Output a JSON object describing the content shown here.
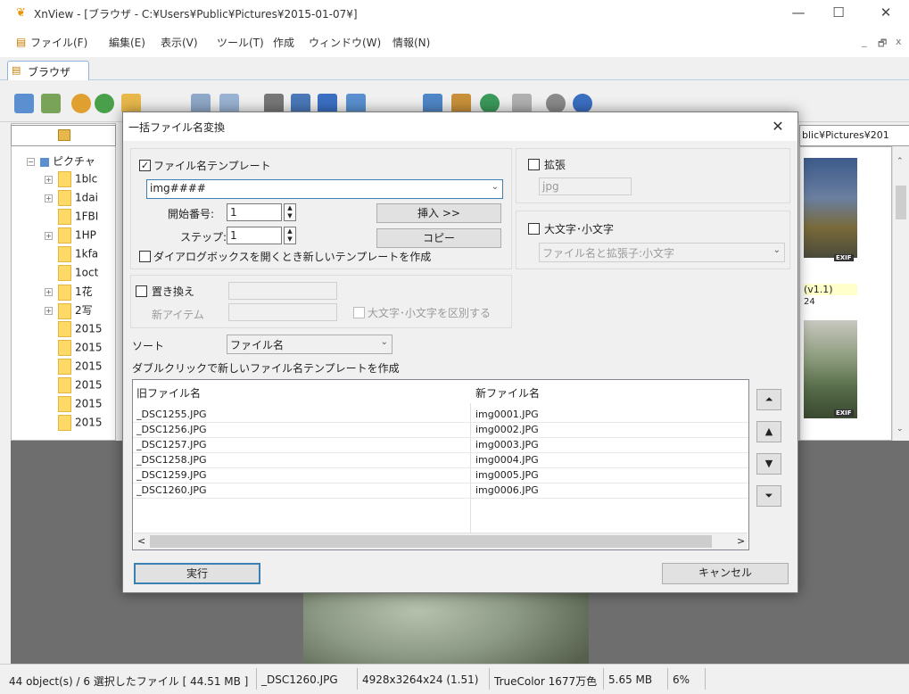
{
  "window": {
    "title": "XnView - [ブラウザ - C:¥Users¥Public¥Pictures¥2015-01-07¥]",
    "minimize": "—",
    "maximize": "☐",
    "close": "✕"
  },
  "menubar": {
    "items": [
      "ファイル(F)",
      "編集(E)",
      "表示(V)",
      "ツール(T)",
      "作成",
      "ウィンドウ(W)",
      "情報(N)"
    ],
    "mdi_min": "_",
    "mdi_restore": "🗗",
    "mdi_close": "x"
  },
  "tab": {
    "label": "ブラウザ"
  },
  "path_right": "blic¥Pictures¥201",
  "tree": {
    "root": "ピクチャ",
    "items": [
      "1blc",
      "1dai",
      "1FBI",
      "1HP",
      "1kfa",
      "1oct",
      "1花",
      "2写",
      "2015",
      "2015",
      "2015",
      "2015",
      "2015",
      "2015"
    ]
  },
  "thumbs": {
    "badge": "EXIF",
    "caption1_line1": "(v1.1)",
    "caption1_line2": "24"
  },
  "dialog": {
    "title": "一括ファイル名変換",
    "close": "✕",
    "template": {
      "checkbox_label": "ファイル名テンプレート",
      "checked": "✓",
      "value": "img####",
      "start_label": "開始番号:",
      "start_value": "1",
      "step_label": "ステップ:",
      "step_value": "1",
      "insert_button": "挿入 >>",
      "copy_button": "コピー",
      "new_template_label": "ダイアログボックスを開くとき新しいテンプレートを作成"
    },
    "extension": {
      "checkbox_label": "拡張",
      "value": "jpg"
    },
    "case": {
      "checkbox_label": "大文字･小文字",
      "select_value": "ファイル名と拡張子:小文字"
    },
    "replace": {
      "checkbox_label": "置き換え",
      "new_item_label": "新アイテム",
      "case_sensitive_label": "大文字･小文字を区別する"
    },
    "sort": {
      "label": "ソート",
      "value": "ファイル名"
    },
    "hint": "ダブルクリックで新しいファイル名テンプレートを作成",
    "list": {
      "col_old": "旧ファイル名",
      "col_new": "新ファイル名",
      "rows": [
        {
          "old": "_DSC1255.JPG",
          "new": "img0001.JPG"
        },
        {
          "old": "_DSC1256.JPG",
          "new": "img0002.JPG"
        },
        {
          "old": "_DSC1257.JPG",
          "new": "img0003.JPG"
        },
        {
          "old": "_DSC1258.JPG",
          "new": "img0004.JPG"
        },
        {
          "old": "_DSC1259.JPG",
          "new": "img0005.JPG"
        },
        {
          "old": "_DSC1260.JPG",
          "new": "img0006.JPG"
        }
      ],
      "scroll_left": "<",
      "scroll_right": ">"
    },
    "move": {
      "top": "⏶",
      "up": "▲",
      "down": "▼",
      "bottom": "⏷"
    },
    "run_button": "実行",
    "cancel_button": "キャンセル"
  },
  "statusbar": {
    "objects": "44 object(s) / 6 選択したファイル [ 44.51 MB ]",
    "filename": "_DSC1260.JPG",
    "dimensions": "4928x3264x24 (1.51)",
    "color": "TrueColor 1677万色",
    "size": "5.65 MB",
    "zoom": "6%"
  },
  "colors": {
    "accent": "#3c7fb1",
    "dialog_bg": "#f0f0f0",
    "folder": "#ffd966"
  }
}
